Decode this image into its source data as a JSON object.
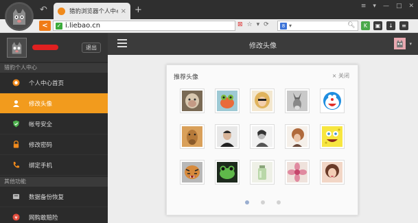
{
  "browser": {
    "tab_title": "猎豹浏览器个人中心",
    "url": "i.liebao.cn",
    "new_tab_symbol": "+",
    "tab_close_symbol": "×"
  },
  "sidebar": {
    "logout_label": "退出",
    "sections": [
      {
        "title": "猎豹个人中心"
      },
      {
        "title": "其他功能"
      }
    ],
    "items": [
      {
        "label": "个人中心首页",
        "icon": "home-icon"
      },
      {
        "label": "修改头像",
        "icon": "user-icon",
        "active": true
      },
      {
        "label": "帐号安全",
        "icon": "shield-icon"
      },
      {
        "label": "修改密码",
        "icon": "lock-icon"
      },
      {
        "label": "绑定手机",
        "icon": "phone-icon"
      },
      {
        "label": "数据备份恢复",
        "icon": "backup-icon"
      },
      {
        "label": "网购敢赔险",
        "icon": "insurance-icon"
      }
    ]
  },
  "main": {
    "page_title": "修改头像",
    "panel": {
      "title": "推荐头像",
      "close_label": "× 关闭",
      "avatars": [
        "monkey",
        "frog-toy",
        "blonde-girl",
        "donkey",
        "doraemon",
        "camel",
        "man-portrait",
        "woman-bw",
        "girl-hair",
        "spongebob",
        "tiger",
        "frog-green",
        "glass-jar",
        "pink-flower",
        "girl-photo"
      ],
      "pages": 3,
      "current_page": 1
    }
  },
  "colors": {
    "accent": "#f29b1d",
    "sidebar_bg": "#2b2b2b",
    "topbar_bg": "#3b3b3b",
    "chrome_bg": "#2f2f2f"
  }
}
